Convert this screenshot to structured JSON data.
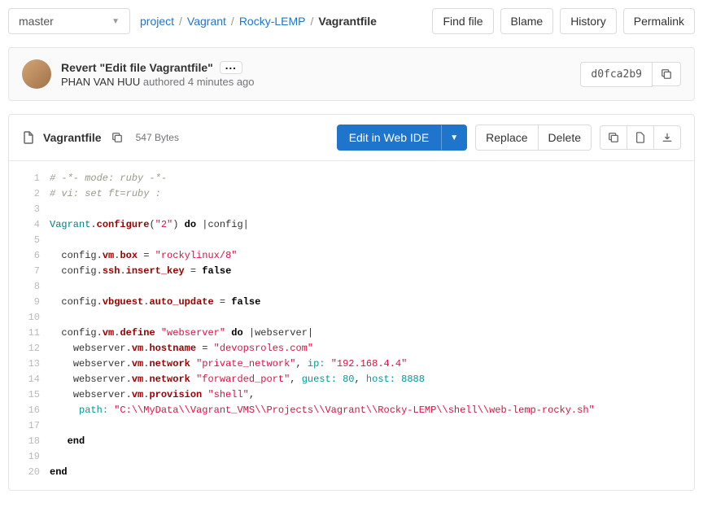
{
  "branch": "master",
  "breadcrumb": {
    "parts": [
      "project",
      "Vagrant",
      "Rocky-LEMP"
    ],
    "current": "Vagrantfile"
  },
  "actions": {
    "find_file": "Find file",
    "blame": "Blame",
    "history": "History",
    "permalink": "Permalink"
  },
  "commit": {
    "title": "Revert \"Edit file Vagrantfile\"",
    "author": "PHAN VAN HUU",
    "authored_text": "authored",
    "time_ago": "4 minutes ago",
    "sha": "d0fca2b9"
  },
  "file": {
    "name": "Vagrantfile",
    "size": "547 Bytes",
    "edit_label": "Edit in Web IDE",
    "replace": "Replace",
    "delete": "Delete"
  },
  "code": {
    "lines": [
      {
        "type": "comment",
        "text": "# -*- mode: ruby -*-"
      },
      {
        "type": "comment",
        "text": "# vi: set ft=ruby :"
      },
      {
        "type": "blank"
      },
      {
        "type": "cfg",
        "tokens": [
          [
            "const",
            "Vagrant"
          ],
          [
            "plain",
            "."
          ],
          [
            "method",
            "configure"
          ],
          [
            "plain",
            "("
          ],
          [
            "string",
            "\"2\""
          ],
          [
            "plain",
            ") "
          ],
          [
            "keyword",
            "do"
          ],
          [
            "plain",
            " |config|"
          ]
        ]
      },
      {
        "type": "blank"
      },
      {
        "type": "cfg",
        "indent": "  ",
        "tokens": [
          [
            "plain",
            "config"
          ],
          [
            "plain",
            "."
          ],
          [
            "method",
            "vm"
          ],
          [
            "plain",
            "."
          ],
          [
            "method",
            "box"
          ],
          [
            "plain",
            " = "
          ],
          [
            "string",
            "\"rockylinux/8\""
          ]
        ]
      },
      {
        "type": "cfg",
        "indent": "  ",
        "tokens": [
          [
            "plain",
            "config"
          ],
          [
            "plain",
            "."
          ],
          [
            "method",
            "ssh"
          ],
          [
            "plain",
            "."
          ],
          [
            "method",
            "insert_key"
          ],
          [
            "plain",
            " = "
          ],
          [
            "keyword",
            "false"
          ]
        ]
      },
      {
        "type": "blank"
      },
      {
        "type": "cfg",
        "indent": "  ",
        "tokens": [
          [
            "plain",
            "config"
          ],
          [
            "plain",
            "."
          ],
          [
            "method",
            "vbguest"
          ],
          [
            "plain",
            "."
          ],
          [
            "method",
            "auto_update"
          ],
          [
            "plain",
            " = "
          ],
          [
            "keyword",
            "false"
          ]
        ]
      },
      {
        "type": "blank"
      },
      {
        "type": "cfg",
        "indent": "  ",
        "tokens": [
          [
            "plain",
            "config"
          ],
          [
            "plain",
            "."
          ],
          [
            "method",
            "vm"
          ],
          [
            "plain",
            "."
          ],
          [
            "method",
            "define"
          ],
          [
            "plain",
            " "
          ],
          [
            "string",
            "\"webserver\""
          ],
          [
            "plain",
            " "
          ],
          [
            "keyword",
            "do"
          ],
          [
            "plain",
            " |webserver|"
          ]
        ]
      },
      {
        "type": "cfg",
        "indent": "    ",
        "tokens": [
          [
            "plain",
            "webserver"
          ],
          [
            "plain",
            "."
          ],
          [
            "method",
            "vm"
          ],
          [
            "plain",
            "."
          ],
          [
            "method",
            "hostname"
          ],
          [
            "plain",
            " = "
          ],
          [
            "string",
            "\"devopsroles.com\""
          ]
        ]
      },
      {
        "type": "cfg",
        "indent": "    ",
        "tokens": [
          [
            "plain",
            "webserver"
          ],
          [
            "plain",
            "."
          ],
          [
            "method",
            "vm"
          ],
          [
            "plain",
            "."
          ],
          [
            "method",
            "network"
          ],
          [
            "plain",
            " "
          ],
          [
            "string",
            "\"private_network\""
          ],
          [
            "plain",
            ", "
          ],
          [
            "sym",
            "ip: "
          ],
          [
            "string",
            "\"192.168.4.4\""
          ]
        ]
      },
      {
        "type": "cfg",
        "indent": "    ",
        "tokens": [
          [
            "plain",
            "webserver"
          ],
          [
            "plain",
            "."
          ],
          [
            "method",
            "vm"
          ],
          [
            "plain",
            "."
          ],
          [
            "method",
            "network"
          ],
          [
            "plain",
            " "
          ],
          [
            "string",
            "\"forwarded_port\""
          ],
          [
            "plain",
            ", "
          ],
          [
            "sym",
            "guest: "
          ],
          [
            "num",
            "80"
          ],
          [
            "plain",
            ", "
          ],
          [
            "sym",
            "host: "
          ],
          [
            "num",
            "8888"
          ]
        ]
      },
      {
        "type": "cfg",
        "indent": "    ",
        "tokens": [
          [
            "plain",
            "webserver"
          ],
          [
            "plain",
            "."
          ],
          [
            "method",
            "vm"
          ],
          [
            "plain",
            "."
          ],
          [
            "method",
            "provision"
          ],
          [
            "plain",
            " "
          ],
          [
            "string",
            "\"shell\""
          ],
          [
            "plain",
            ","
          ]
        ]
      },
      {
        "type": "cfg",
        "indent": "     ",
        "tokens": [
          [
            "sym",
            "path: "
          ],
          [
            "string",
            "\"C:\\\\MyData\\\\Vagrant_VMS\\\\Projects\\\\Vagrant\\\\Rocky-LEMP\\\\shell\\\\web-lemp-rocky.sh\""
          ]
        ]
      },
      {
        "type": "blank"
      },
      {
        "type": "cfg",
        "indent": "   ",
        "tokens": [
          [
            "keyword",
            "end"
          ]
        ]
      },
      {
        "type": "blank"
      },
      {
        "type": "cfg",
        "indent": "",
        "tokens": [
          [
            "keyword",
            "end"
          ]
        ]
      }
    ]
  }
}
